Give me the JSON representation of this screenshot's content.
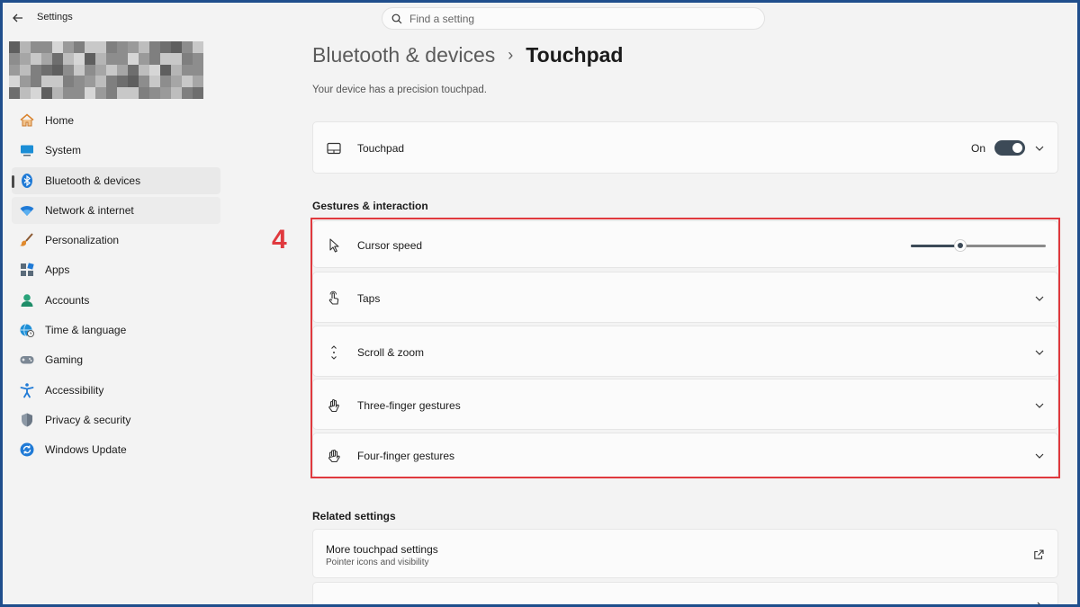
{
  "window": {
    "title": "Settings"
  },
  "search": {
    "placeholder": "Find a setting"
  },
  "sidebar": {
    "items": [
      {
        "label": "Home",
        "icon": "home-icon"
      },
      {
        "label": "System",
        "icon": "system-icon"
      },
      {
        "label": "Bluetooth & devices",
        "icon": "bluetooth-icon",
        "selected": true
      },
      {
        "label": "Network & internet",
        "icon": "wifi-icon"
      },
      {
        "label": "Personalization",
        "icon": "brush-icon"
      },
      {
        "label": "Apps",
        "icon": "apps-icon"
      },
      {
        "label": "Accounts",
        "icon": "accounts-icon"
      },
      {
        "label": "Time & language",
        "icon": "globe-clock-icon"
      },
      {
        "label": "Gaming",
        "icon": "gamepad-icon"
      },
      {
        "label": "Accessibility",
        "icon": "accessibility-icon"
      },
      {
        "label": "Privacy & security",
        "icon": "shield-icon"
      },
      {
        "label": "Windows Update",
        "icon": "update-icon"
      }
    ]
  },
  "breadcrumb": {
    "parent": "Bluetooth & devices",
    "separator": "›",
    "current": "Touchpad"
  },
  "subtitle": "Your device has a precision touchpad.",
  "touchpad": {
    "label": "Touchpad",
    "state_label": "On",
    "enabled": true
  },
  "gestures": {
    "heading": "Gestures & interaction",
    "cursor_speed": {
      "label": "Cursor speed",
      "value_fraction": 0.35
    },
    "taps": "Taps",
    "scroll_zoom": "Scroll & zoom",
    "three_finger": "Three-finger gestures",
    "four_finger": "Four-finger gestures"
  },
  "annotation": {
    "step": "4",
    "color": "#e0393e"
  },
  "related": {
    "heading": "Related settings",
    "more_touchpad": {
      "title": "More touchpad settings",
      "subtitle": "Pointer icons and visibility"
    }
  },
  "colors": {
    "accent": "#3c4a57",
    "selected_bg": "#e9e9e9",
    "frame": "#1f4e8c"
  }
}
